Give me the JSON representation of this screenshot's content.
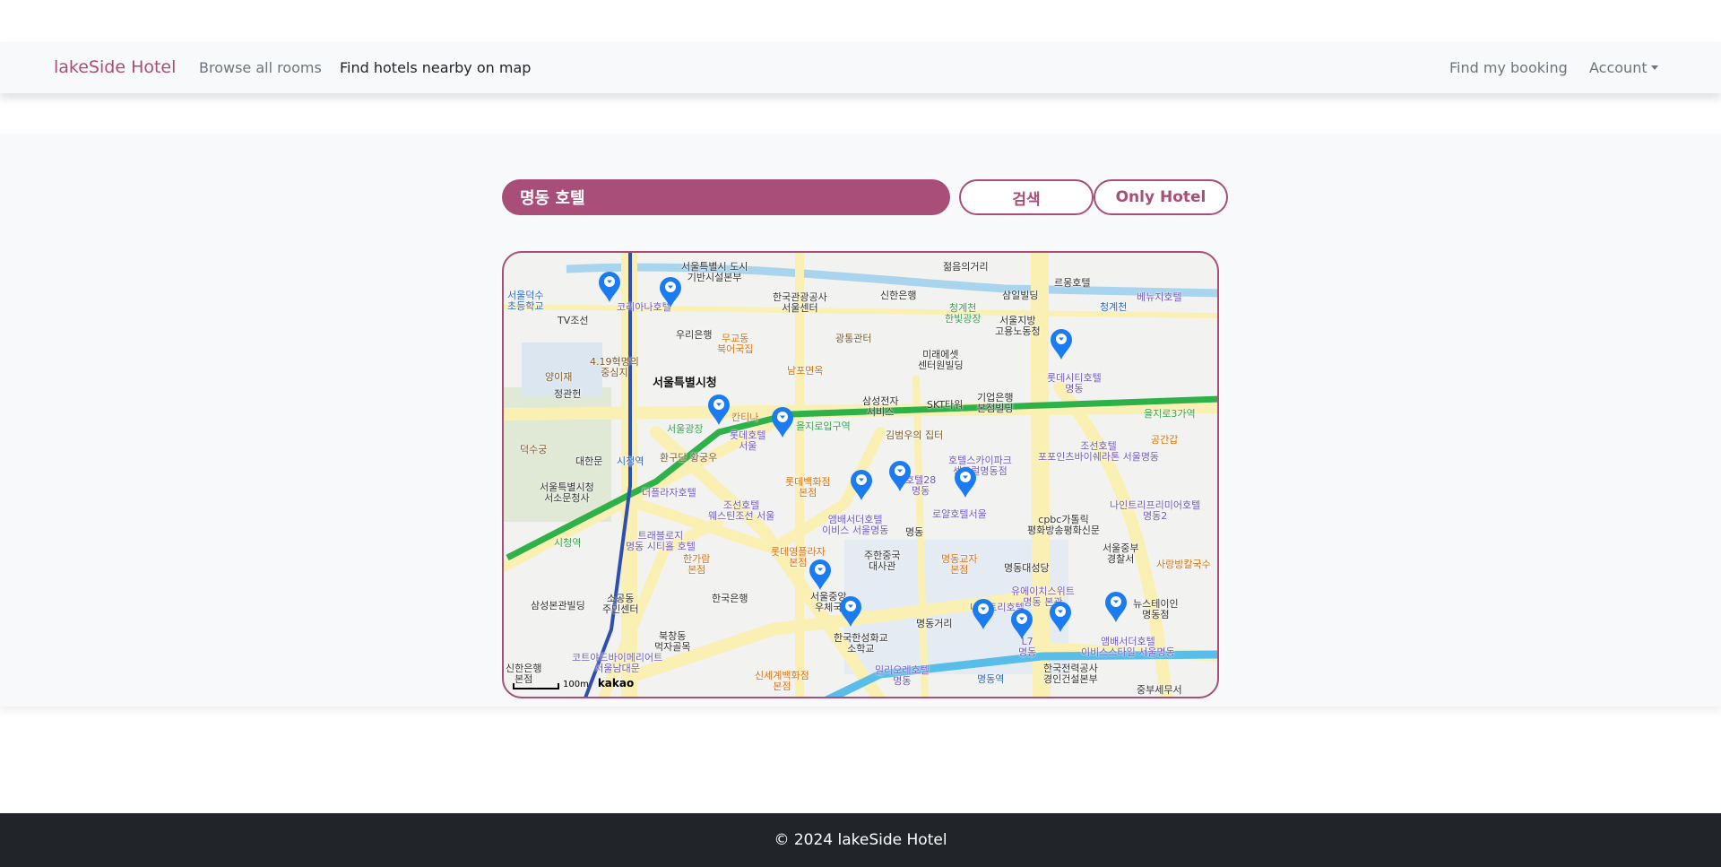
{
  "navbar": {
    "brand": "lakeSide Hotel",
    "links": [
      "Browse all rooms",
      "Find hotels nearby on map"
    ],
    "right_links": [
      "Find my booking",
      "Account"
    ]
  },
  "search": {
    "value": "명동 호텔",
    "search_label": "검색",
    "only_hotel_label": "Only Hotel"
  },
  "map": {
    "accent": "#a84e78",
    "marker_color": "#1a7cf0",
    "scale_label": "100m",
    "attribution": "kakao",
    "labels": [
      {
        "t": "서울특별시 도시\n기반시설본부",
        "c": ""
      },
      {
        "t": "서울덕수\n초등학교",
        "c": "blue"
      },
      {
        "t": "TV조선",
        "c": ""
      },
      {
        "t": "코리아나호텔",
        "c": "purple"
      },
      {
        "t": "우리은행",
        "c": ""
      },
      {
        "t": "한국관광공사\n서울센터",
        "c": ""
      },
      {
        "t": "무교동\n북어국집",
        "c": "orange"
      },
      {
        "t": "신한은행",
        "c": ""
      },
      {
        "t": "청계천\n한빛광장",
        "c": "green"
      },
      {
        "t": "젊음의거리",
        "c": ""
      },
      {
        "t": "삼일빌딩",
        "c": ""
      },
      {
        "t": "르몽호텔",
        "c": ""
      },
      {
        "t": "베뉴지호텔",
        "c": "purple"
      },
      {
        "t": "청계천",
        "c": "blue"
      },
      {
        "t": "서울지방\n고용노동청",
        "c": ""
      },
      {
        "t": "광통관터",
        "c": "brown"
      },
      {
        "t": "미래에셋\n센터원빌딩",
        "c": ""
      },
      {
        "t": "4.19혁명의\n중심지",
        "c": "brown"
      },
      {
        "t": "남포면옥",
        "c": "orange"
      },
      {
        "t": "양이재",
        "c": "brown"
      },
      {
        "t": "서울특별시청",
        "c": "bold"
      },
      {
        "t": "정관헌",
        "c": ""
      },
      {
        "t": "롯데시티호텔\n명동",
        "c": "purple"
      },
      {
        "t": "삼성전자\n서비스",
        "c": ""
      },
      {
        "t": "SKT타워",
        "c": ""
      },
      {
        "t": "기업은행\n본점빌딩",
        "c": ""
      },
      {
        "t": "을지로입구역",
        "c": "green"
      },
      {
        "t": "을지로3가역",
        "c": "green"
      },
      {
        "t": "칸티나",
        "c": "orange"
      },
      {
        "t": "서울광장",
        "c": "green"
      },
      {
        "t": "롯데호텔\n서울",
        "c": "purple"
      },
      {
        "t": "김범우의 집터",
        "c": "brown"
      },
      {
        "t": "공간갑",
        "c": "orange"
      },
      {
        "t": "조선호텔\n포포인츠바이쉐라톤 서울명동",
        "c": "purple"
      },
      {
        "t": "덕수궁",
        "c": "brown"
      },
      {
        "t": "환구단 황궁우",
        "c": "brown"
      },
      {
        "t": "대한문",
        "c": ""
      },
      {
        "t": "시청역",
        "c": "blue"
      },
      {
        "t": "호텔스카이파크\n센트럴명동점",
        "c": "purple"
      },
      {
        "t": "롯데백화점\n본점",
        "c": "orange"
      },
      {
        "t": "호텔28\n명동",
        "c": "purple"
      },
      {
        "t": "로얄호텔서울",
        "c": "purple"
      },
      {
        "t": "서울특별시청\n서소문청사",
        "c": ""
      },
      {
        "t": "더플라자호텔",
        "c": "purple"
      },
      {
        "t": "조선호텔\n웨스틴조선 서울",
        "c": "purple"
      },
      {
        "t": "나인트리프리미어호텔\n명동2",
        "c": "purple"
      },
      {
        "t": "앰배서더호텔\n이비스 서울명동",
        "c": "purple"
      },
      {
        "t": "cpbc가톨릭\n평화방송평화신문",
        "c": ""
      },
      {
        "t": "명동",
        "c": ""
      },
      {
        "t": "시청역",
        "c": "green"
      },
      {
        "t": "트래블로지\n명동 시티홀 호텔",
        "c": "purple"
      },
      {
        "t": "서울중부\n경찰서",
        "c": ""
      },
      {
        "t": "롯데영플라자\n본점",
        "c": "orange"
      },
      {
        "t": "주한중국\n대사관",
        "c": ""
      },
      {
        "t": "명동교자\n본점",
        "c": "orange"
      },
      {
        "t": "한가람\n본점",
        "c": "orange"
      },
      {
        "t": "명동대성당",
        "c": ""
      },
      {
        "t": "사랑방칼국수",
        "c": "orange"
      },
      {
        "t": "한국은행",
        "c": ""
      },
      {
        "t": "유에이치스위트\n명동 본관",
        "c": "purple"
      },
      {
        "t": "삼성본관빌딩",
        "c": ""
      },
      {
        "t": "소공동\n주민센터",
        "c": ""
      },
      {
        "t": "서울중앙\n우체국",
        "c": ""
      },
      {
        "t": "뉴스테이인\n명동점",
        "c": ""
      },
      {
        "t": "나인트리호텔",
        "c": "purple"
      },
      {
        "t": "명동거리",
        "c": ""
      },
      {
        "t": "한국한성화교\n소학교",
        "c": ""
      },
      {
        "t": "L7\n명동",
        "c": "purple"
      },
      {
        "t": "북창동\n먹자골목",
        "c": ""
      },
      {
        "t": "앰배서더호텔\n이비스스타일 서울명동",
        "c": "purple"
      },
      {
        "t": "코트야드바이메리어트\n서울남대문",
        "c": "purple"
      },
      {
        "t": "신한은행\n본점",
        "c": ""
      },
      {
        "t": "밀리오레호텔\n명동",
        "c": "purple"
      },
      {
        "t": "명동역",
        "c": "blue"
      },
      {
        "t": "한국전력공사\n경인건설본부",
        "c": ""
      },
      {
        "t": "신세계백화점\n본점",
        "c": "orange"
      },
      {
        "t": "중부세무서",
        "c": ""
      }
    ]
  },
  "footer": {
    "text": "© 2024 lakeSide Hotel"
  }
}
